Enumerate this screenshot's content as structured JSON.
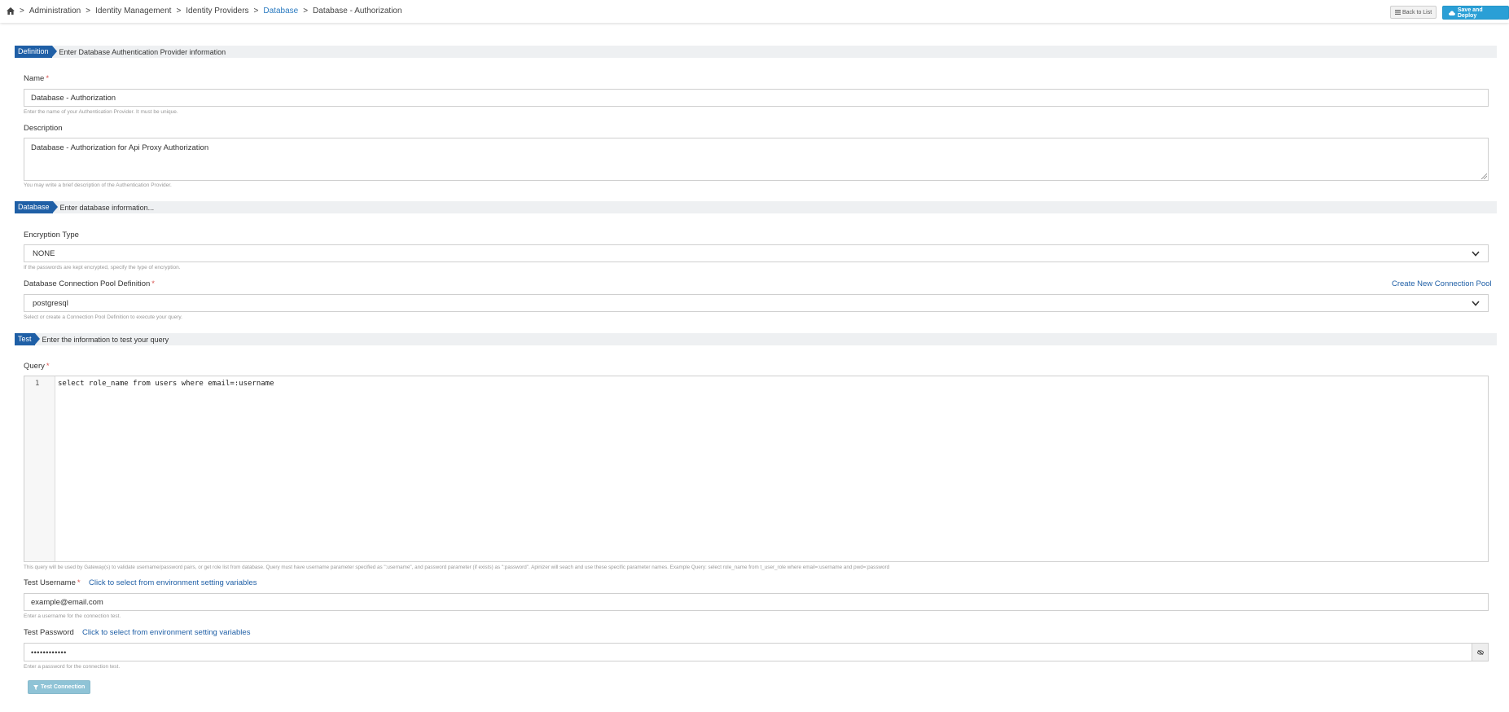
{
  "breadcrumb": {
    "items": [
      "Administration",
      "Identity Management",
      "Identity Providers",
      "Database",
      "Database - Authorization"
    ],
    "separator": ">"
  },
  "toolbar": {
    "back_label": "Back to List",
    "save_label": "Save and Deploy",
    "save_color": "#2a9fd6"
  },
  "sections": {
    "definition": {
      "tag": "Definition",
      "desc": "Enter Database Authentication Provider information"
    },
    "database": {
      "tag": "Database",
      "desc": "Enter database information..."
    },
    "test": {
      "tag": "Test",
      "desc": "Enter the information to test your query"
    }
  },
  "form": {
    "name": {
      "label": "Name",
      "value": "Database - Authorization",
      "help": "Enter the name of your Authentication Provider. It must be unique."
    },
    "description": {
      "label": "Description",
      "value": "Database - Authorization for Api Proxy Authorization",
      "help": "You may write a brief description of the Authentication Provider."
    },
    "encryption_type": {
      "label": "Encryption Type",
      "value": "NONE",
      "help": "If the passwords are kept encrypted, specify the type of encryption."
    },
    "connection_pool": {
      "label": "Database Connection Pool Definition",
      "value": "postgresql",
      "help": "Select or create a Connection Pool Definition to execute your query.",
      "create_link": "Create New Connection Pool"
    },
    "query": {
      "label": "Query",
      "line_number": "1",
      "code": "select role_name from users where email=:username",
      "help": "This query will be used by Gateway(s) to validate username/password pairs, or get role list from database. Query must have username parameter specified as \":username\", and password parameter (if exists) as \":password\". Apinizer will seach and use these specific parameter names. Example Query: select role_name from t_user_role where email=:username and pwd=:password"
    },
    "test_username": {
      "label": "Test Username",
      "env_link": "Click to select from environment setting variables",
      "value": "example@email.com",
      "help": "Enter a username for the connection test."
    },
    "test_password": {
      "label": "Test Password",
      "env_link": "Click to select from environment setting variables",
      "value": "••••••••••••",
      "help": "Enter a password for the connection test."
    },
    "test_button": "Test Connection"
  },
  "colors": {
    "accent": "#1f5fa6",
    "required": "#d9534f",
    "link": "#1f5fa6"
  }
}
